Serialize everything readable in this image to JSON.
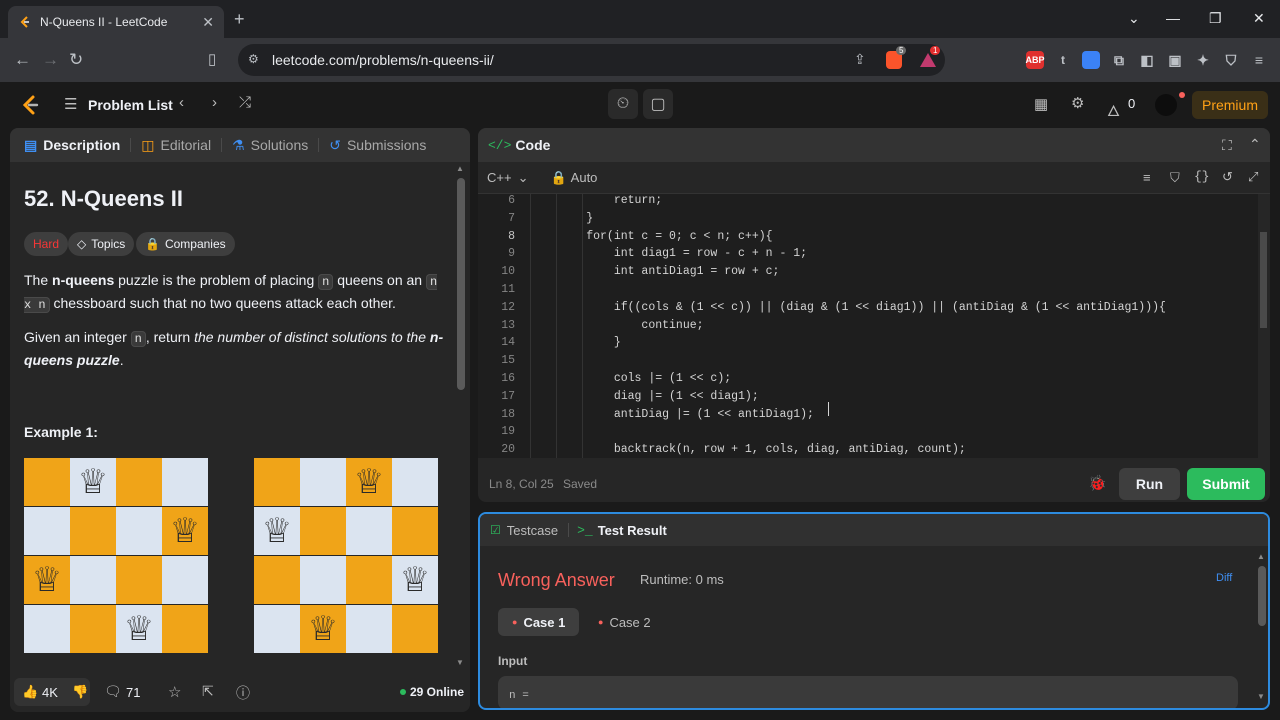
{
  "browser": {
    "tab_title": "N-Queens II - LeetCode",
    "url": "leetcode.com/problems/n-queens-ii/",
    "extension_badges": [
      "5",
      "1"
    ],
    "extension_labels": [
      "ABP",
      "t"
    ]
  },
  "lc_nav": {
    "problem_list": "Problem List",
    "streak_count": "0",
    "premium": "Premium"
  },
  "left_panel": {
    "tabs": [
      "Description",
      "Editorial",
      "Solutions",
      "Submissions"
    ],
    "title": "52. N-Queens II",
    "difficulty": "Hard",
    "chips": [
      "Topics",
      "Companies"
    ],
    "para1": {
      "t1": "The ",
      "b1": "n-queens",
      "t2": " puzzle is the problem of placing ",
      "c1": "n",
      "t3": " queens on an ",
      "c2": "n x n",
      "t4": " chessboard such that no two queens attack each other."
    },
    "para2": {
      "t1": "Given an integer ",
      "c1": "n",
      "t2": ", return ",
      "i1": "the number of distinct solutions to the ",
      "b1": "n-queens puzzle",
      "t3": "."
    },
    "example_heading": "Example 1:",
    "footer": {
      "likes": "4K",
      "comments": "71",
      "online": "29 Online"
    }
  },
  "code_panel": {
    "title": "Code",
    "language": "C++",
    "mode": "Auto",
    "current_line": "8",
    "lines": [
      {
        "n": "6",
        "text": "            return;"
      },
      {
        "n": "7",
        "text": "        }"
      },
      {
        "n": "8",
        "text": "        for(int c = 0; c < n; c++){"
      },
      {
        "n": "9",
        "text": "            int diag1 = row - c + n - 1;"
      },
      {
        "n": "10",
        "text": "            int antiDiag1 = row + c;"
      },
      {
        "n": "11",
        "text": ""
      },
      {
        "n": "12",
        "text": "            if((cols & (1 << c)) || (diag & (1 << diag1)) || (antiDiag & (1 << antiDiag1))){"
      },
      {
        "n": "13",
        "text": "                continue;"
      },
      {
        "n": "14",
        "text": "            }"
      },
      {
        "n": "15",
        "text": ""
      },
      {
        "n": "16",
        "text": "            cols |= (1 << c);"
      },
      {
        "n": "17",
        "text": "            diag |= (1 << diag1);"
      },
      {
        "n": "18",
        "text": "            antiDiag |= (1 << antiDiag1);"
      },
      {
        "n": "19",
        "text": ""
      },
      {
        "n": "20",
        "text": "            backtrack(n, row + 1, cols, diag, antiDiag, count);"
      }
    ],
    "status_position": "Ln 8, Col 25",
    "status_saved": "Saved",
    "run_label": "Run",
    "submit_label": "Submit"
  },
  "result_panel": {
    "tab_testcase": "Testcase",
    "tab_result": "Test Result",
    "verdict": "Wrong Answer",
    "runtime": "Runtime: 0 ms",
    "diff": "Diff",
    "cases": [
      "Case 1",
      "Case 2"
    ],
    "input_label": "Input",
    "input_value": "n ="
  },
  "colors": {
    "accent_green": "#2cbb5d",
    "verdict_red": "#f8615c",
    "premium_orange": "#ffa116",
    "focus_blue": "#2d8bdf"
  }
}
